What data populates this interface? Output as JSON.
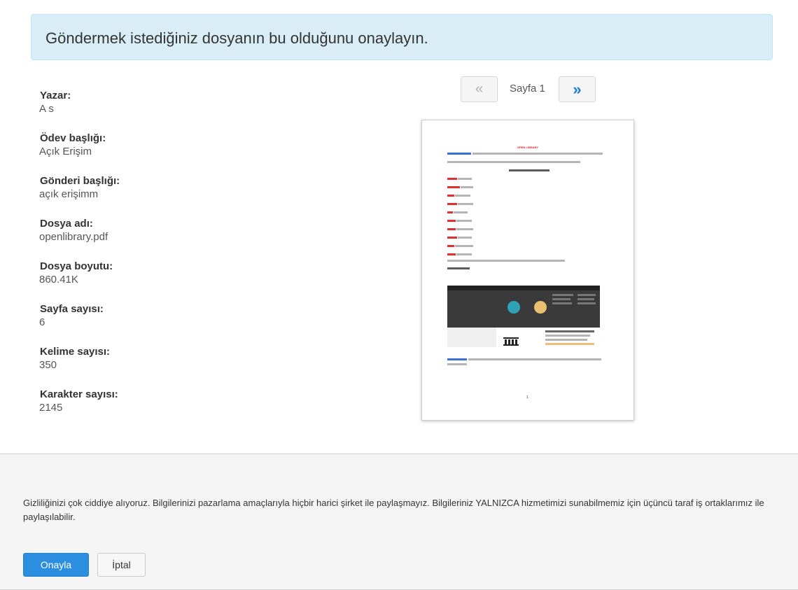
{
  "alert": {
    "text": "Göndermek istediğiniz dosyanın bu olduğunu onaylayın."
  },
  "meta": [
    {
      "label": "Yazar:",
      "value": "A s"
    },
    {
      "label": "Ödev başlığı:",
      "value": "Açık Erişim"
    },
    {
      "label": "Gönderi başlığı:",
      "value": "açık erişimm"
    },
    {
      "label": "Dosya adı:",
      "value": "openlibrary.pdf"
    },
    {
      "label": "Dosya boyutu:",
      "value": "860.41K"
    },
    {
      "label": "Sayfa sayısı:",
      "value": "6"
    },
    {
      "label": "Kelime sayısı:",
      "value": "350"
    },
    {
      "label": "Karakter sayısı:",
      "value": "2145"
    }
  ],
  "pager": {
    "prev": "«",
    "next": "»",
    "label": "Sayfa 1"
  },
  "preview": {
    "title": "OPEN LIBRARY",
    "page_number": "1"
  },
  "footer": {
    "privacy": "Gizliliğinizi çok ciddiye alıyoruz. Bilgilerinizi pazarlama amaçlarıyla hiçbir harici şirket ile paylaşmayız. Bilgileriniz YALNIZCA hizmetimizi sunabilmemiz için üçüncü taraf iş ortaklarımız ile paylaşılabilir.",
    "confirm_label": "Onayla",
    "cancel_label": "İptal"
  },
  "colors": {
    "alert_bg": "#d9edf7",
    "primary": "#2b8ee0",
    "link": "#1a7bd8"
  }
}
